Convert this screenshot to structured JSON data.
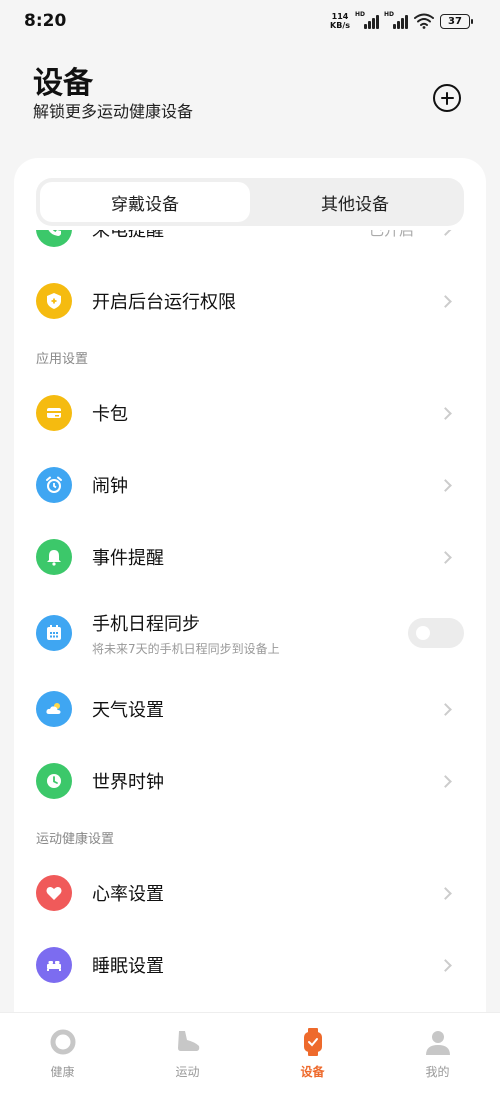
{
  "status_bar": {
    "time": "8:20",
    "net_speed_value": "114",
    "net_speed_unit": "KB/s",
    "network_label": "HD",
    "battery": "37"
  },
  "header": {
    "title": "设备",
    "subtitle": "解锁更多运动健康设备",
    "add_icon": "plus-circle-icon"
  },
  "segment": {
    "tabs": [
      {
        "label": "穿戴设备",
        "active": true
      },
      {
        "label": "其他设备",
        "active": false
      }
    ]
  },
  "list": {
    "call_reminder": {
      "label": "来电提醒",
      "value": "已开启",
      "icon": "phone-icon",
      "color": "#3cc86a"
    },
    "background_permission": {
      "label": "开启后台运行权限",
      "icon": "shield-icon",
      "color": "#f5bb10"
    },
    "app_settings_section": "应用设置",
    "wallet": {
      "label": "卡包",
      "icon": "card-icon",
      "color": "#f5bb10"
    },
    "alarm": {
      "label": "闹钟",
      "icon": "alarm-clock-icon",
      "color": "#3fa6f2"
    },
    "event_reminder": {
      "label": "事件提醒",
      "icon": "bell-icon",
      "color": "#3cc86a"
    },
    "calendar_sync": {
      "label": "手机日程同步",
      "sub": "将未来7天的手机日程同步到设备上",
      "icon": "calendar-icon",
      "color": "#3fa6f2",
      "enabled": false
    },
    "weather": {
      "label": "天气设置",
      "icon": "weather-icon",
      "color": "#3fa6f2"
    },
    "world_clock": {
      "label": "世界时钟",
      "icon": "clock-icon",
      "color": "#3cc86a"
    },
    "health_section": "运动健康设置",
    "heart_rate": {
      "label": "心率设置",
      "icon": "heart-icon",
      "color": "#f05a5a"
    },
    "sleep": {
      "label": "睡眠设置",
      "icon": "bed-icon",
      "color": "#7c6cf0"
    }
  },
  "tabbar": {
    "tabs": [
      {
        "label": "健康",
        "icon": "ring-icon",
        "active": false
      },
      {
        "label": "运动",
        "icon": "shoe-icon",
        "active": false
      },
      {
        "label": "设备",
        "icon": "watch-icon",
        "active": true
      },
      {
        "label": "我的",
        "icon": "person-icon",
        "active": false
      }
    ],
    "active_color": "#ee6a2c"
  }
}
